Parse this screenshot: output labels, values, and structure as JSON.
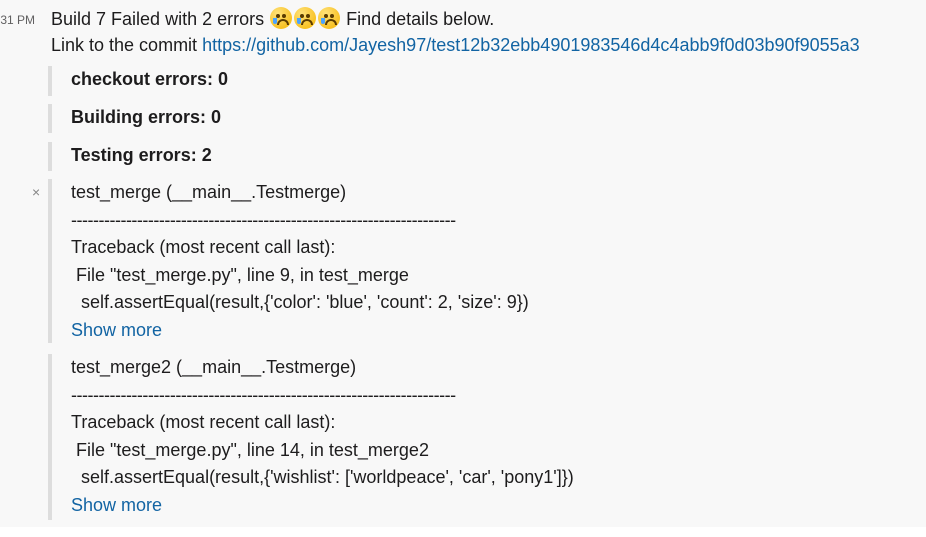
{
  "time": "31 PM",
  "header": {
    "text_before": "Build 7 Failed with 2 errors",
    "emojis": [
      "crying-face",
      "crying-face",
      "crying-face"
    ],
    "text_after": "Find details below."
  },
  "commit": {
    "label": "Link to the commit",
    "url": "https://github.com/Jayesh97/test12b32ebb4901983546d4c4abb9f0d03b90f9055a3"
  },
  "summary": [
    "checkout errors: 0",
    "Building errors: 0",
    "Testing errors: 2"
  ],
  "close_icon": "×",
  "tests": [
    {
      "title": "test_merge (__main__.Testmerge)",
      "divider": "----------------------------------------------------------------------",
      "traceback_header": "Traceback (most recent call last):",
      "file_line": " File \"test_merge.py\", line 9, in test_merge",
      "code_line": "  self.assertEqual(result,{'color': 'blue', 'count': 2, 'size': 9})",
      "show_more": "Show more"
    },
    {
      "title": "test_merge2 (__main__.Testmerge)",
      "divider": "----------------------------------------------------------------------",
      "traceback_header": "Traceback (most recent call last):",
      "file_line": " File \"test_merge.py\", line 14, in test_merge2",
      "code_line": "  self.assertEqual(result,{'wishlist': ['worldpeace', 'car', 'pony1']})",
      "show_more": "Show more"
    }
  ]
}
